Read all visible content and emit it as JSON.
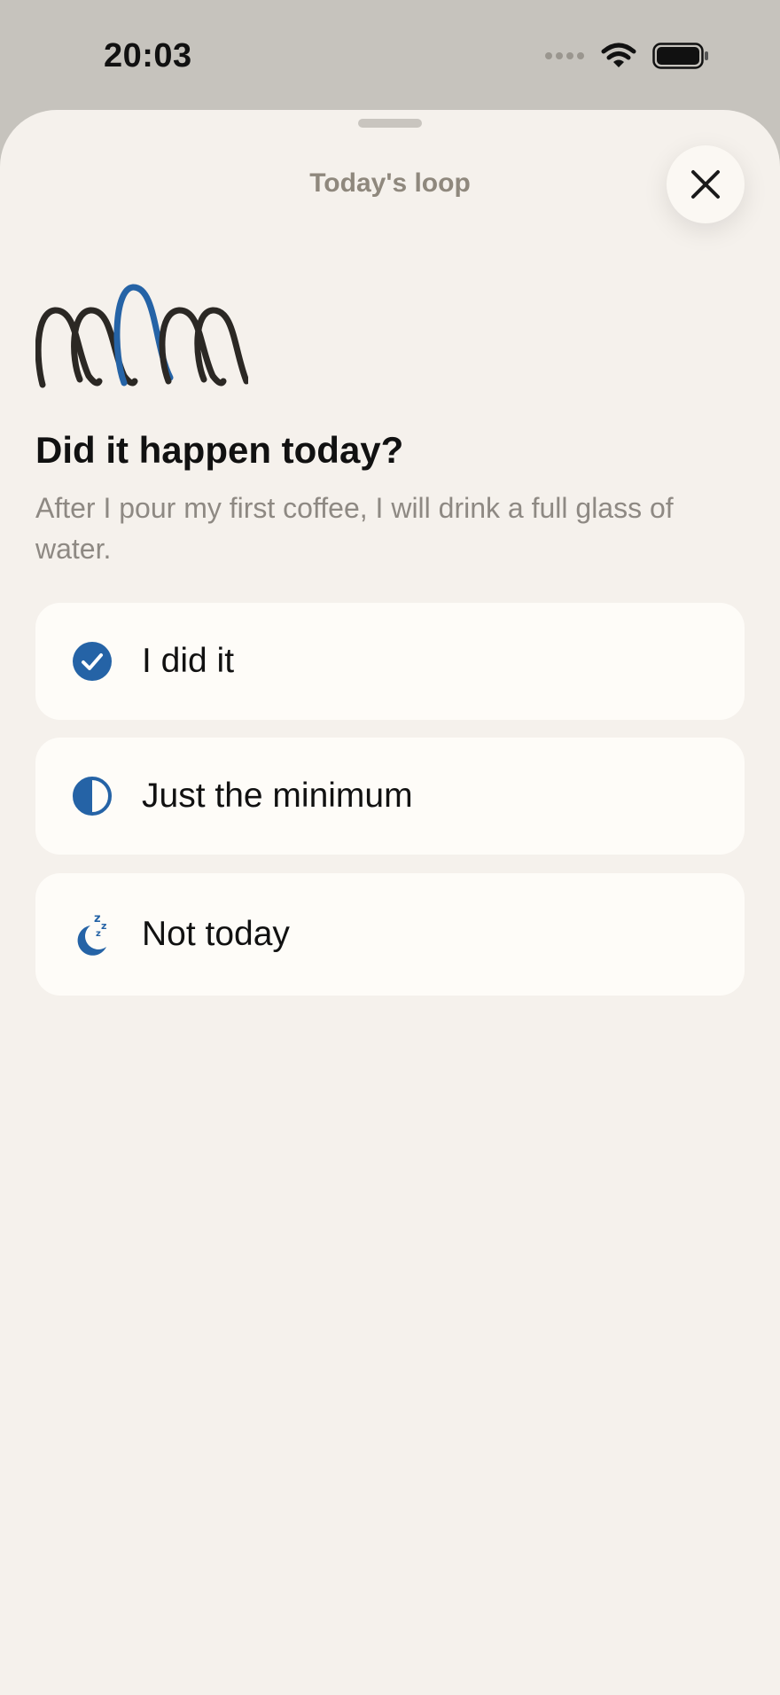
{
  "status_bar": {
    "time": "20:03"
  },
  "sheet": {
    "title": "Today's loop",
    "close_icon": "close-icon"
  },
  "prompt": {
    "question": "Did it happen today?",
    "description": "After I pour my first coffee, I will drink a full glass of water."
  },
  "options": [
    {
      "label": "I did it",
      "icon": "checkmark-circle-icon"
    },
    {
      "label": "Just the minimum",
      "icon": "half-circle-icon"
    },
    {
      "label": "Not today",
      "icon": "moon-zzz-icon"
    }
  ],
  "colors": {
    "accent": "#2563a6",
    "loop_dark": "#2b2824",
    "sheet_background": "#f5f1ec",
    "card_background": "#fefcf8",
    "muted_text": "#8e8983"
  }
}
